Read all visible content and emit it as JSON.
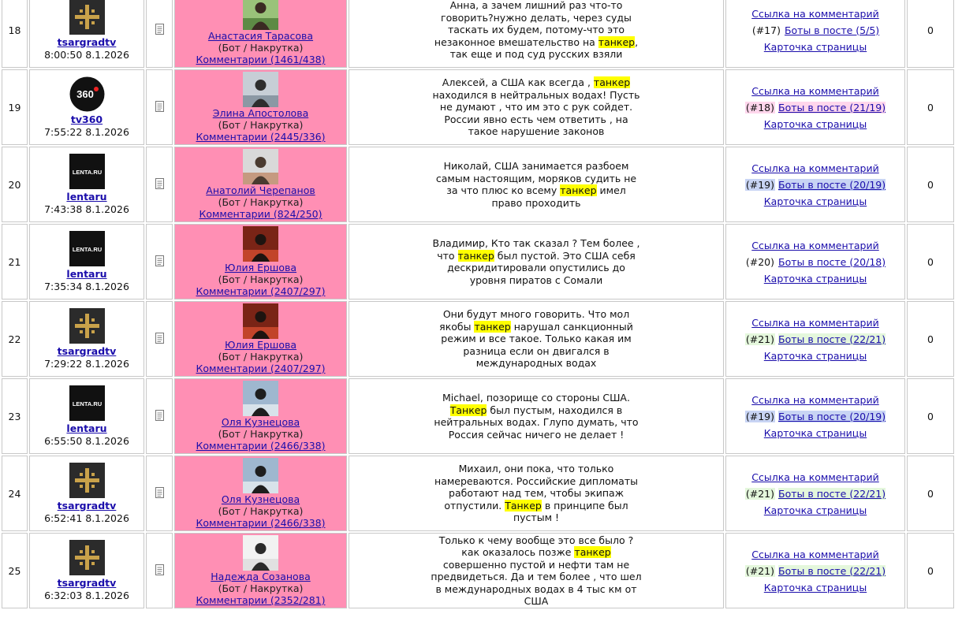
{
  "rows": [
    {
      "num": "18",
      "source": {
        "name": "tsargradtv",
        "time": "8:00:50 8.1.2026",
        "logo": "tsargrad"
      },
      "author": {
        "name": "Анастасия Тарасова",
        "role": "(Бот / Накрутка)",
        "comments": "Комментарии (1461/438)",
        "avatar": "avatar-green"
      },
      "text": {
        "before": "Анна, а зачем лишний раз что-то говорить?нужно делать, через суды таскать их будем, потому-что это незаконное вмешательство на ",
        "keyword": "танкер",
        "after": ", так еще и под суд русских взяли"
      },
      "links": {
        "comment_link": "Ссылка на комментарий",
        "tag": "(#17)",
        "tag_color": "",
        "bots": "Боты в посте (5/5)",
        "card": "Карточка страницы"
      },
      "count": "0"
    },
    {
      "num": "19",
      "source": {
        "name": "tv360",
        "time": "7:55:22 8.1.2026",
        "logo": "tv360"
      },
      "author": {
        "name": "Элина Апостолова",
        "role": "(Бот / Накрутка)",
        "comments": "Комментарии (2445/336)",
        "avatar": "avatar-grey"
      },
      "text": {
        "before": "Алексей, а США как всегда , ",
        "keyword": "танкер",
        "after": " находился в нейтральных водах! Пусть не думают , что им это с рук сойдет. России явно есть чем ответить , на такое нарушение законов"
      },
      "links": {
        "comment_link": "Ссылка на комментарий",
        "tag": "(#18)",
        "tag_color": "#ffd6ec",
        "bots": "Боты в посте (21/19)",
        "card": "Карточка страницы"
      },
      "count": "0"
    },
    {
      "num": "20",
      "source": {
        "name": "lentaru",
        "time": "7:43:38 8.1.2026",
        "logo": "lenta"
      },
      "author": {
        "name": "Анатолий Черепанов",
        "role": "(Бот / Накрутка)",
        "comments": "Комментарии (824/250)",
        "avatar": "avatar-face"
      },
      "text": {
        "before": "Николай, США занимается разбоем самым настоящим, моряков судить не за что плюс ко всему ",
        "keyword": "танкер",
        "after": " имел право проходить"
      },
      "links": {
        "comment_link": "Ссылка на комментарий",
        "tag": "(#19)",
        "tag_color": "#c8d4f4",
        "bots": "Боты в посте (20/19)",
        "card": "Карточка страницы"
      },
      "count": "0"
    },
    {
      "num": "21",
      "source": {
        "name": "lentaru",
        "time": "7:35:34 8.1.2026",
        "logo": "lenta"
      },
      "author": {
        "name": "Юлия Ершова",
        "role": "(Бот / Накрутка)",
        "comments": "Комментарии (2407/297)",
        "avatar": "avatar-red"
      },
      "text": {
        "before": "Владимир, Кто так сказал ? Тем более , что ",
        "keyword": "танкер",
        "after": " был пустой. Это США себя дескридитировали опустились до уровня пиратов с Сомали"
      },
      "links": {
        "comment_link": "Ссылка на комментарий",
        "tag": "(#20)",
        "tag_color": "",
        "bots": "Боты в посте (20/18)",
        "card": "Карточка страницы"
      },
      "count": "0"
    },
    {
      "num": "22",
      "source": {
        "name": "tsargradtv",
        "time": "7:29:22 8.1.2026",
        "logo": "tsargrad"
      },
      "author": {
        "name": "Юлия Ершова",
        "role": "(Бот / Накрутка)",
        "comments": "Комментарии (2407/297)",
        "avatar": "avatar-red"
      },
      "text": {
        "before": "Они будут много говорить. Что мол якобы ",
        "keyword": "танкер",
        "after": " нарушал санкционный режим и все такое. Только какая им разница если он двигался в международных водах"
      },
      "links": {
        "comment_link": "Ссылка на комментарий",
        "tag": "(#21)",
        "tag_color": "#e4f7dc",
        "bots": "Боты в посте (22/21)",
        "card": "Карточка страницы"
      },
      "count": "0"
    },
    {
      "num": "23",
      "source": {
        "name": "lentaru",
        "time": "6:55:50 8.1.2026",
        "logo": "lenta"
      },
      "author": {
        "name": "Оля Кузнецова",
        "role": "(Бот / Накрутка)",
        "comments": "Комментарии (2466/338)",
        "avatar": "avatar-sea"
      },
      "text": {
        "before": "Michael, позорище со стороны США. ",
        "keyword": "Танкер",
        "after": " был пустым, находился в нейтральных водах. Глупо думать, что Россия сейчас ничего не делает !"
      },
      "links": {
        "comment_link": "Ссылка на комментарий",
        "tag": "(#19)",
        "tag_color": "#c8d4f4",
        "bots": "Боты в посте (20/19)",
        "card": "Карточка страницы"
      },
      "count": "0"
    },
    {
      "num": "24",
      "source": {
        "name": "tsargradtv",
        "time": "6:52:41 8.1.2026",
        "logo": "tsargrad"
      },
      "author": {
        "name": "Оля Кузнецова",
        "role": "(Бот / Накрутка)",
        "comments": "Комментарии (2466/338)",
        "avatar": "avatar-sea"
      },
      "text": {
        "before": "Михаил, они пока, что только намереваются. Российские дипломаты работают над тем, чтобы экипаж отпустили. ",
        "keyword": "Танкер",
        "after": " в принципе был пустым !"
      },
      "links": {
        "comment_link": "Ссылка на комментарий",
        "tag": "(#21)",
        "tag_color": "#e4f7dc",
        "bots": "Боты в посте (22/21)",
        "card": "Карточка страницы"
      },
      "count": "0"
    },
    {
      "num": "25",
      "source": {
        "name": "tsargradtv",
        "time": "6:32:03 8.1.2026",
        "logo": "tsargrad"
      },
      "author": {
        "name": "Надежда Созанова",
        "role": "(Бот / Накрутка)",
        "comments": "Комментарии (2352/281)",
        "avatar": "avatar-light"
      },
      "text": {
        "before": "Только к чему вообще это все было ? как оказалось позже ",
        "keyword": "танкер",
        "after": " совершенно пустой и нефти там не предвидеться. Да и тем более , что шел в международных водах в 4 тыс км от США"
      },
      "links": {
        "comment_link": "Ссылка на комментарий",
        "tag": "(#21)",
        "tag_color": "#e4f7dc",
        "bots": "Боты в посте (22/21)",
        "card": "Карточка страницы"
      },
      "count": "0"
    }
  ],
  "logo_text": {
    "lenta": "LENTA.RU",
    "tv360": "360"
  },
  "colors": {
    "author_bg": "#ff8fb4",
    "highlight": "#ffff00",
    "link": "#1a0dab"
  }
}
